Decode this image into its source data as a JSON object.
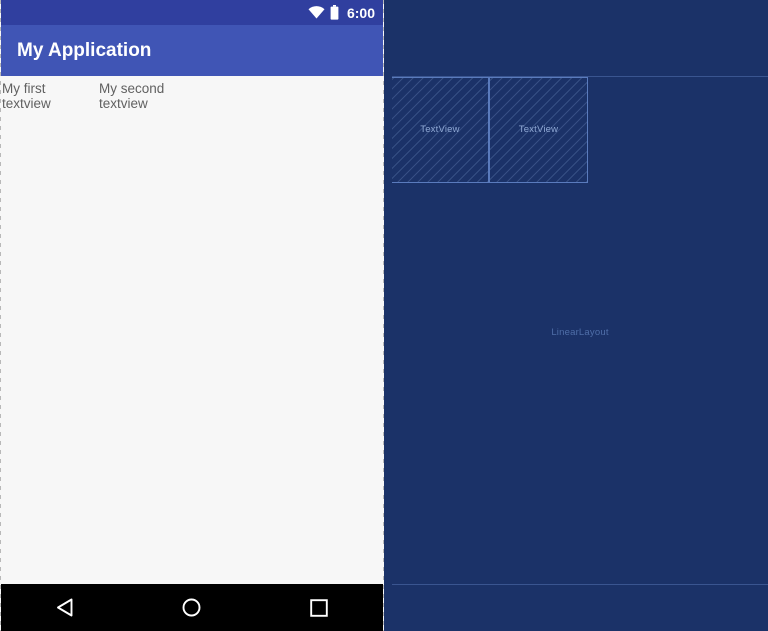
{
  "preview": {
    "status_bar": {
      "time": "6:00",
      "wifi_icon": "wifi-icon",
      "battery_icon": "battery-icon"
    },
    "app_bar": {
      "title": "My Application"
    },
    "textviews": [
      {
        "text": "My first\ntextview"
      },
      {
        "text": "My second\ntextview"
      }
    ],
    "nav_bar": {
      "back_icon": "back-triangle-icon",
      "home_icon": "home-circle-icon",
      "recents_icon": "recents-square-icon"
    }
  },
  "blueprint": {
    "components": [
      {
        "label": "TextView"
      },
      {
        "label": "TextView"
      }
    ],
    "root_label": "LinearLayout"
  },
  "colors": {
    "status_bar": "#303F9F",
    "app_bar": "#4055B5",
    "preview_background": "#F7F7F7",
    "nav_bar": "#000000",
    "blueprint_background": "#1B3268",
    "blueprint_stroke": "#5A7BBD",
    "blueprint_text": "#8FA8D4"
  }
}
